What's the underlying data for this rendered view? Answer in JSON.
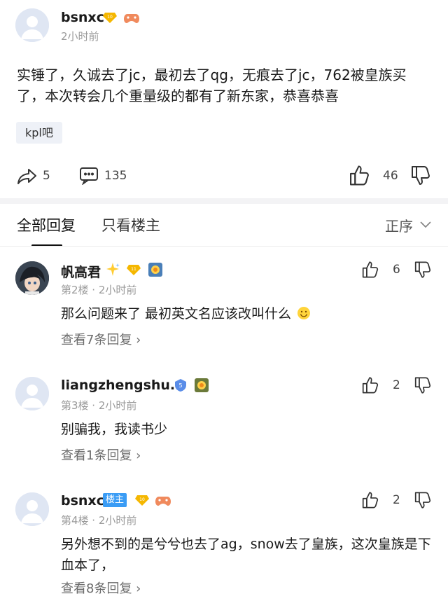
{
  "post": {
    "author": "bsnxc",
    "time": "2小时前",
    "level": "10",
    "text": "实锤了，久诚去了jc，最初去了qg，无痕去了jc，762被皇族买了，本次转会几个重量级的都有了新东家，恭喜恭喜",
    "tag": "kpl吧",
    "share_count": "5",
    "comment_count": "135",
    "like_count": "46"
  },
  "tabs": {
    "all": "全部回复",
    "op_only": "只看楼主",
    "sort": "正序"
  },
  "replies": [
    {
      "author": "帆高君",
      "level": "11",
      "floor_time": "第2楼 · 2小时前",
      "text": "那么问题来了 最初英文名应该改叫什么",
      "view_more": "查看7条回复 ›",
      "likes": "6"
    },
    {
      "author": "liangzhengshu...",
      "level": "5",
      "floor_time": "第3楼 · 2小时前",
      "text": "别骗我，我读书少",
      "view_more": "查看1条回复 ›",
      "likes": "2"
    },
    {
      "author": "bsnxc",
      "op_label": "楼主",
      "level": "10",
      "floor_time": "第4楼 · 2小时前",
      "text": "另外想不到的是兮兮也去了ag，snow去了皇族，这次皇族是下血本了，",
      "view_more": "查看8条回复 ›",
      "likes": "2"
    }
  ],
  "colors": {
    "accent_blue": "#3a9cf5",
    "gold_badge": "#f5b700",
    "divider": "#f3f3f5"
  }
}
